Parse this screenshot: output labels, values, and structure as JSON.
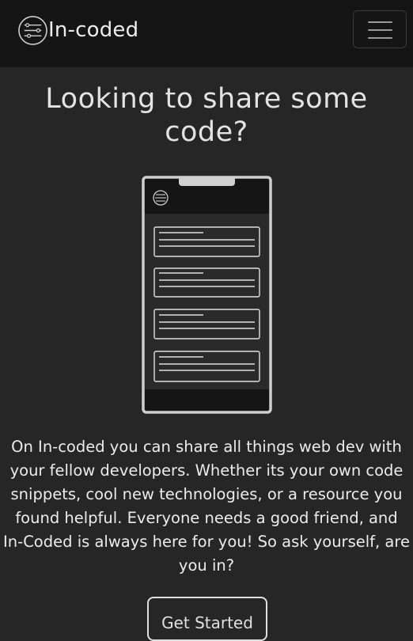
{
  "navbar": {
    "brand_name": "In-coded",
    "logo_icon": "circuit-logo-icon",
    "menu_icon": "hamburger-menu-icon"
  },
  "hero": {
    "title": "Looking to share some code?",
    "illustration_icon": "phone-feed-illustration",
    "description": "On In-coded you can share all things web dev with your fellow developers. Whether its your own code snippets, cool new technologies, or a resource you found helpful. Everyone needs a good friend, and In-Coded is always here for you! So ask yourself, are you in?",
    "cta_label": "Get Started"
  },
  "colors": {
    "page_background": "#262626",
    "navbar_background": "#151515",
    "text": "#e6e6e6"
  }
}
